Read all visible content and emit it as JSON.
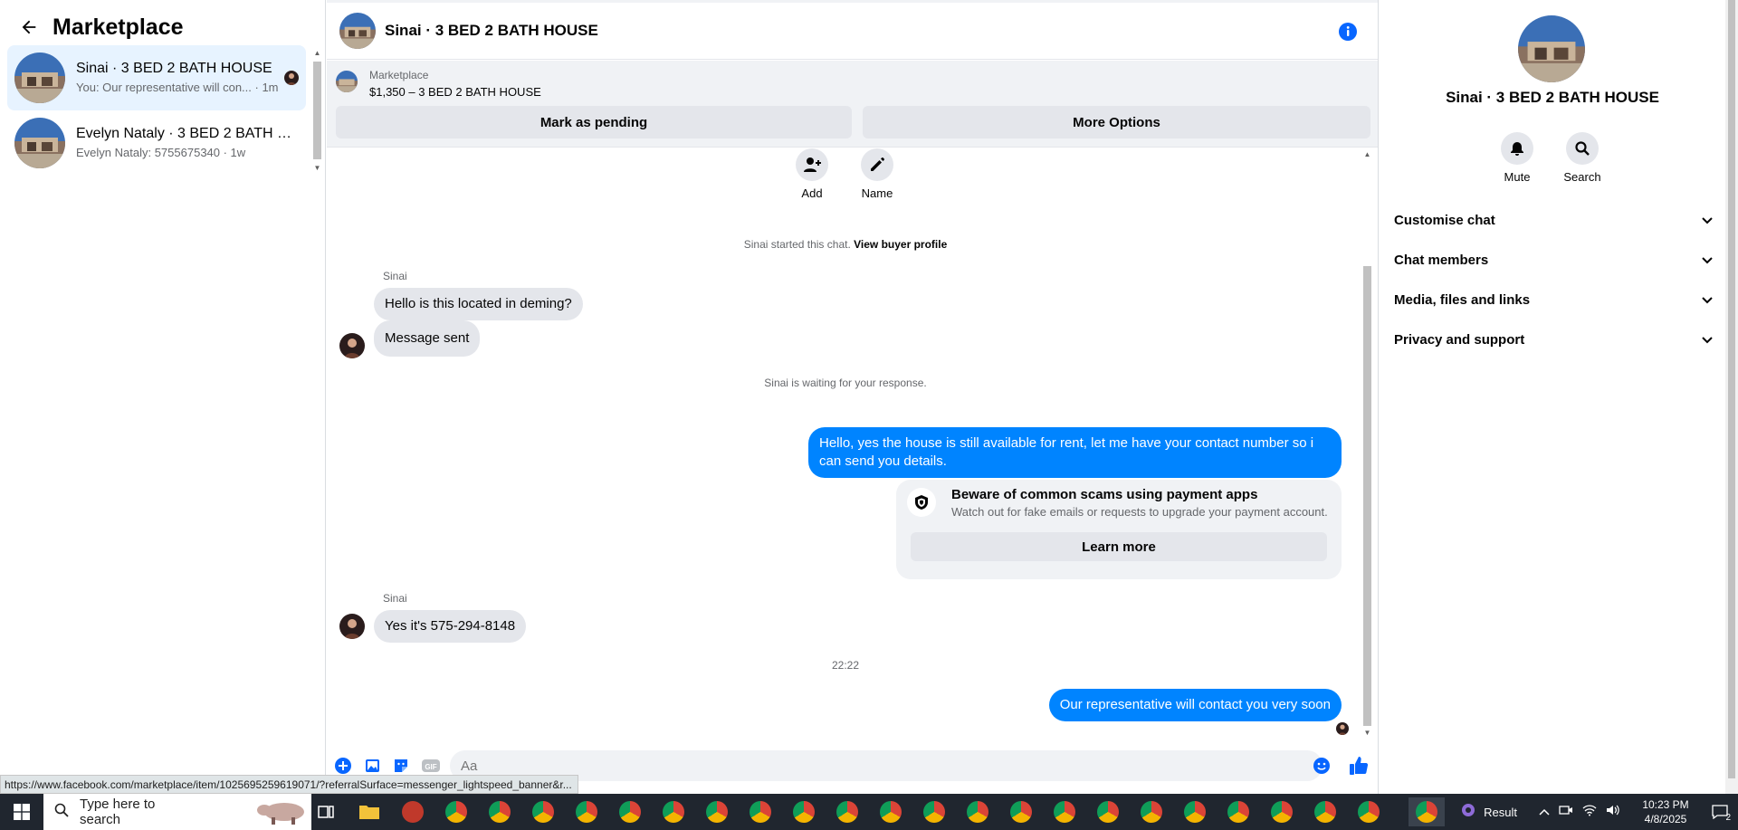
{
  "sidebar": {
    "title": "Marketplace",
    "conversations": [
      {
        "name": "Sinai · 3 BED 2 BATH HOUSE",
        "preview": "You: Our representative will con... · 1m",
        "active": true
      },
      {
        "name": "Evelyn Nataly · 3 BED 2 BATH H...",
        "preview": "Evelyn Nataly: 5755675340 · 1w",
        "active": false
      }
    ]
  },
  "chat": {
    "title": "Sinai · 3 BED 2 BATH HOUSE",
    "listing": {
      "label": "Marketplace",
      "price_title": "$1,350 – 3 BED 2 BATH HOUSE"
    },
    "buttons": {
      "pending": "Mark as pending",
      "more": "More Options"
    },
    "actions": {
      "add": "Add",
      "name": "Name"
    },
    "started_text": "Sinai started this chat.",
    "view_profile": "View buyer profile",
    "sender_name": "Sinai",
    "messages": {
      "m1": "Hello is this located in deming?",
      "m2": "Message sent",
      "waiting": "Sinai is waiting for your response.",
      "m3": "Hello, yes the house is still available for rent, let me have your contact number so i can send you details.",
      "m4": "Yes it's 575-294-8148",
      "time": "22:22",
      "m5": "Our representative will contact you very soon"
    },
    "notice": {
      "title": "Beware of common scams using payment apps",
      "subtitle": "Watch out for fake emails or requests to upgrade your payment account.",
      "button": "Learn more"
    },
    "composer": {
      "placeholder": "Aa"
    }
  },
  "right": {
    "name": "Sinai · 3 BED 2 BATH HOUSE",
    "mute": "Mute",
    "search": "Search",
    "sections": [
      "Customise chat",
      "Chat members",
      "Media, files and links",
      "Privacy and support"
    ]
  },
  "status_url": "https://www.facebook.com/marketplace/item/1025695259619071/?referralSurface=messenger_lightspeed_banner&r...",
  "taskbar": {
    "search_placeholder": "Type here to search",
    "tray_label": "Result",
    "time": "10:23 PM",
    "date": "4/8/2025",
    "notif_count": "2"
  },
  "colors": {
    "accent": "#0084ff",
    "info": "#0866ff"
  }
}
